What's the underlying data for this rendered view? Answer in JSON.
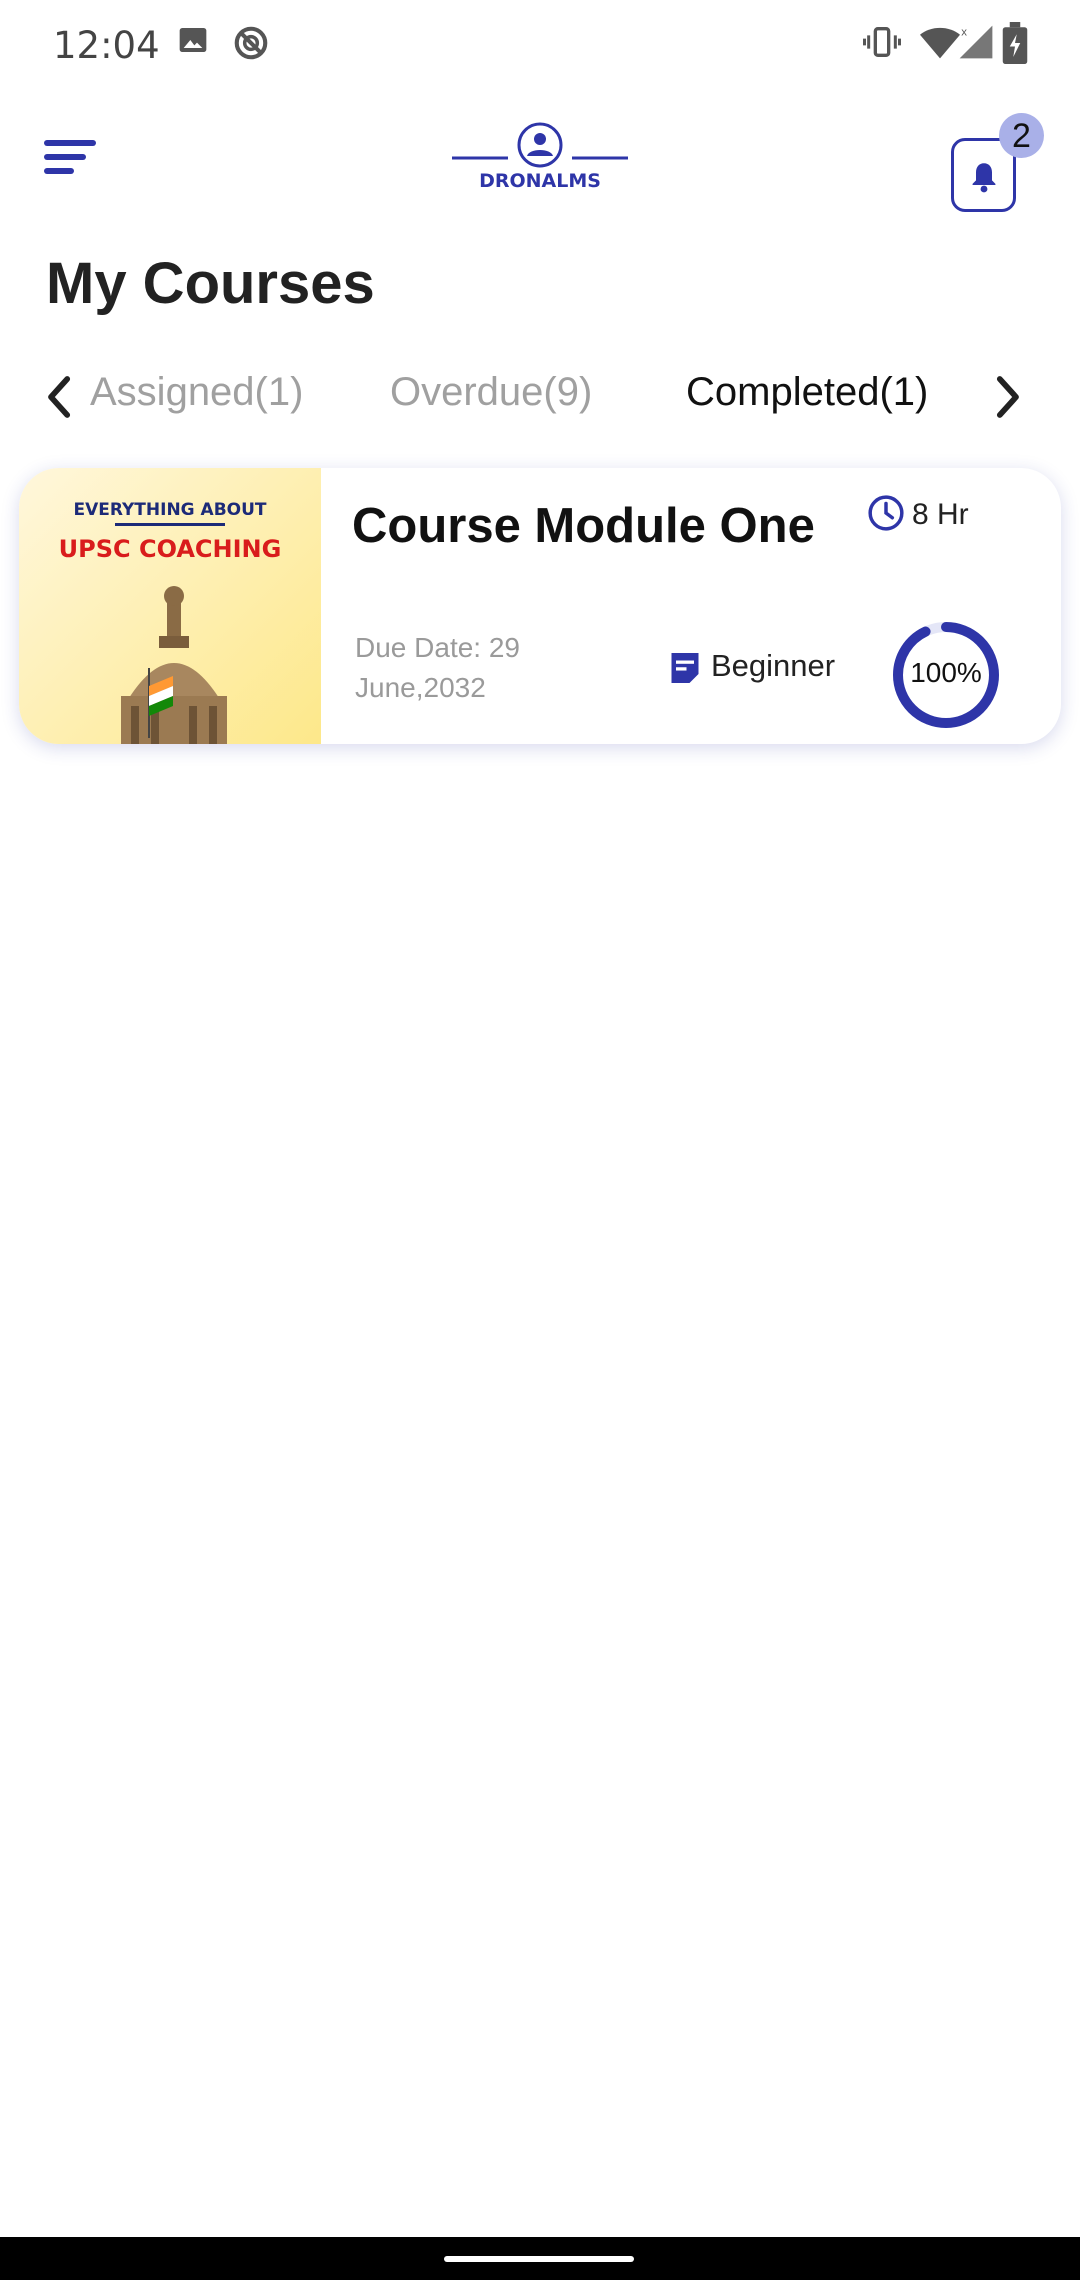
{
  "status_bar": {
    "time": "12:04",
    "icons_left": [
      "image-icon",
      "do-not-disturb-icon"
    ],
    "icons_right": [
      "vibrate-icon",
      "wifi-icon",
      "signal-icon",
      "battery-charging-icon"
    ]
  },
  "header": {
    "menu_icon": "menu-icon",
    "logo_text": "DRONALMS",
    "notification_count": "2",
    "accent_color": "#2e35a8"
  },
  "page": {
    "title": "My Courses"
  },
  "tabs": {
    "items": [
      {
        "label": "Assigned(1)",
        "active": false
      },
      {
        "label": "Overdue(9)",
        "active": false
      },
      {
        "label": "Completed(1)",
        "active": true
      }
    ]
  },
  "courses": [
    {
      "thumbnail_line1": "EVERYTHING ABOUT",
      "thumbnail_line2": "UPSC COACHING",
      "title": "Course Module One",
      "duration": "8 Hr",
      "due_date": "Due Date: 29 June,2032",
      "level": "Beginner",
      "progress_label": "100%",
      "progress": 1.0
    }
  ]
}
